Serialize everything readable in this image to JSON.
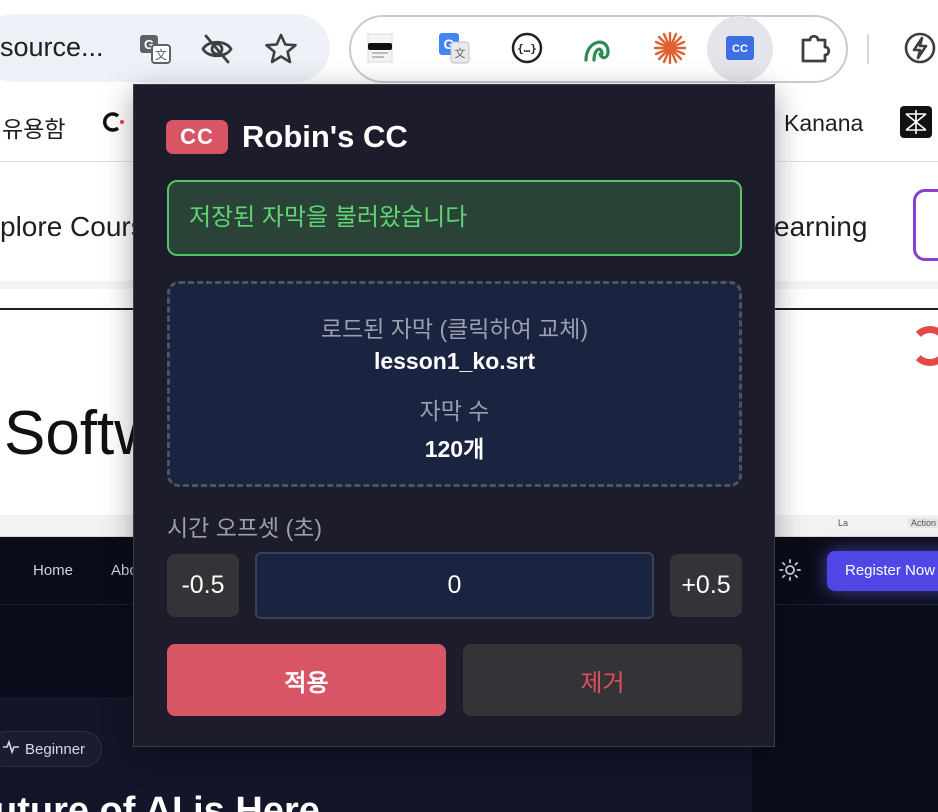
{
  "browser": {
    "address_text": "source...",
    "bookmarks": [
      "유용함",
      "Kanana"
    ]
  },
  "background_page": {
    "nav_left": "plore Cours",
    "nav_right": "earning",
    "hero_text": "Softw",
    "inner_strip": [
      "La",
      "Action"
    ],
    "dark_nav": [
      "Home",
      "Abo"
    ],
    "register_label": "Register Now",
    "badge_label": "Beginner",
    "heading_partial": "uture of AI is Here"
  },
  "popup": {
    "logo_label": "CC",
    "title": "Robin's CC",
    "status_message": "저장된 자막을 불러왔습니다",
    "loaded_label": "로드된 자막 (클릭하여 교체)",
    "file_name": "lesson1_ko.srt",
    "count_label": "자막 수",
    "count_value": "120개",
    "offset_label": "시간 오프셋 (초)",
    "minus_label": "-0.5",
    "offset_value": "0",
    "plus_label": "+0.5",
    "apply_label": "적용",
    "remove_label": "제거"
  },
  "colors": {
    "popup_bg": "#1c1c2a",
    "accent": "#d85566",
    "success": "#5fd475",
    "success_bg": "#2a4336",
    "panel": "#1a2440",
    "remove_text": "#de4f5b"
  },
  "icons": [
    "translate-icon",
    "eye-off-icon",
    "star-icon",
    "incognito-mask-icon",
    "google-translate-icon",
    "json-braces-icon",
    "green-swirl-icon",
    "orange-burst-icon",
    "cc-extension-icon",
    "puzzle-piece-icon",
    "lightning-bolt-icon",
    "sun-icon",
    "activity-pulse-icon"
  ]
}
